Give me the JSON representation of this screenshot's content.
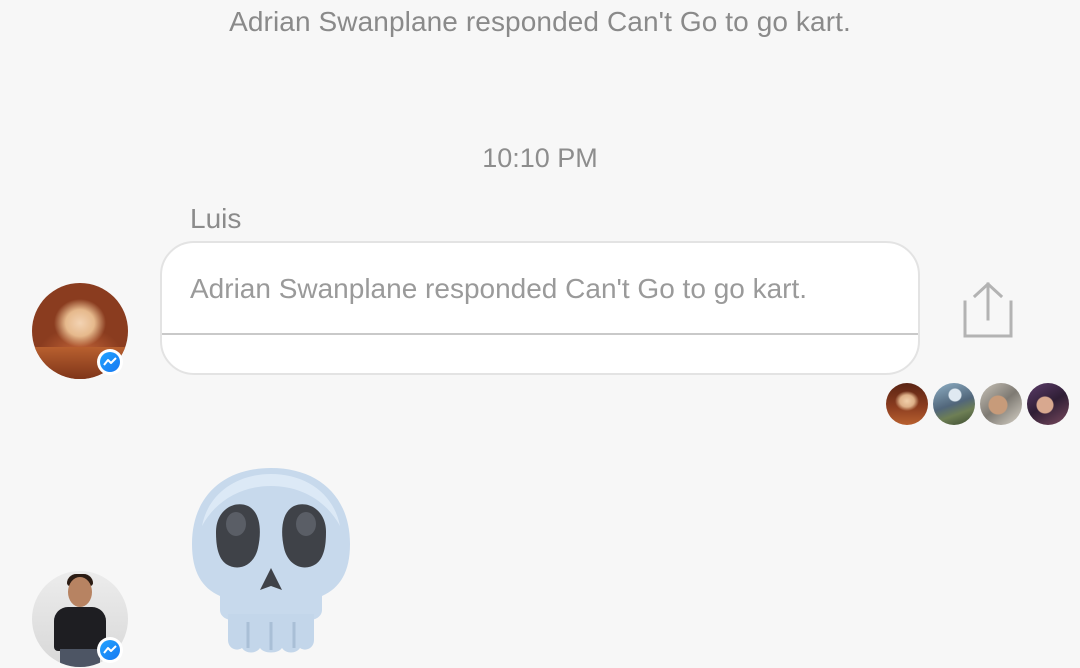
{
  "conversation": {
    "event_text": "Adrian Swanplane responded Can't Go to go kart.",
    "timestamp": "10:10 PM"
  },
  "message": {
    "sender_name": "Luis",
    "card_text": "Adrian Swanplane responded Can't Go to go kart.",
    "share_icon": "share-icon"
  },
  "sticker": {
    "name": "skull-sticker"
  },
  "badges": {
    "platform_icon": "messenger-icon"
  },
  "read_receipts": {
    "count": 4
  },
  "colors": {
    "background": "#f7f7f7",
    "secondary_text": "#8a8a8a",
    "messenger_blue": "#1778f2",
    "skull": "#c7d9ec"
  }
}
